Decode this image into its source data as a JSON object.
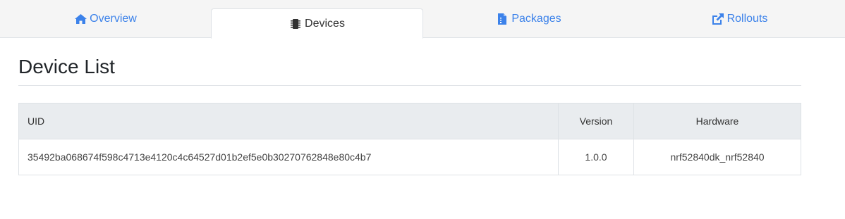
{
  "tabs": [
    {
      "label": "Overview",
      "icon": "home-icon",
      "active": false
    },
    {
      "label": "Devices",
      "icon": "chip-icon",
      "active": true
    },
    {
      "label": "Packages",
      "icon": "file-icon",
      "active": false
    },
    {
      "label": "Rollouts",
      "icon": "external-link-icon",
      "active": false
    }
  ],
  "page": {
    "title": "Device List"
  },
  "table": {
    "headers": {
      "uid": "UID",
      "version": "Version",
      "hardware": "Hardware"
    },
    "rows": [
      {
        "uid": "35492ba068674f598c4713e4120c4c64527d01b2ef5e0b30270762848e80c4b7",
        "version": "1.0.0",
        "hardware": "nrf52840dk_nrf52840"
      }
    ]
  },
  "colors": {
    "link": "#3c82ea",
    "header_bg": "#e9ecef",
    "tabbar_bg": "#f5f5f5"
  }
}
